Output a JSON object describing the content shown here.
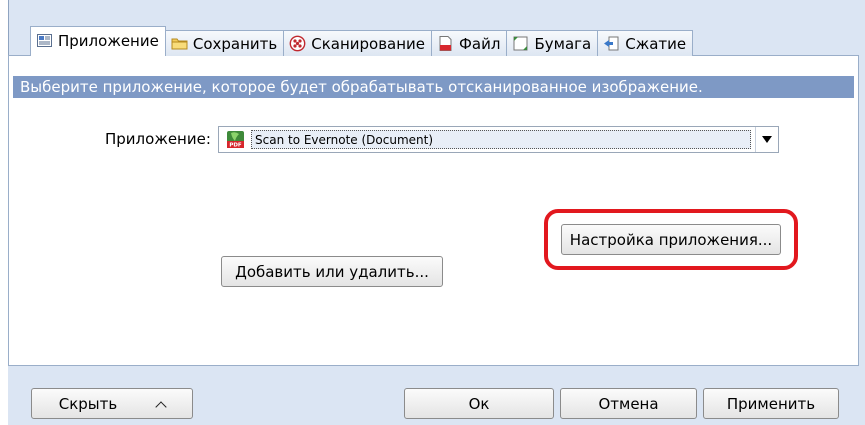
{
  "tabs": [
    {
      "label": "Приложение",
      "icon": "application-icon",
      "active": true
    },
    {
      "label": "Сохранить",
      "icon": "folder-icon",
      "active": false
    },
    {
      "label": "Сканирование",
      "icon": "scan-icon",
      "active": false
    },
    {
      "label": "Файл",
      "icon": "file-icon",
      "active": false
    },
    {
      "label": "Бумага",
      "icon": "paper-icon",
      "active": false
    },
    {
      "label": "Сжатие",
      "icon": "compression-icon",
      "active": false
    }
  ],
  "info_text": "Выберите приложение, которое будет обрабатывать отсканированное изображение.",
  "application": {
    "label": "Приложение:",
    "selected": "Scan to Evernote (Document)",
    "icon": "pdf-icon"
  },
  "buttons": {
    "app_settings": "Настройка приложения...",
    "add_remove": "Добавить или удалить...",
    "hide": "Скрыть",
    "ok": "Ок",
    "cancel": "Отмена",
    "apply": "Применить"
  },
  "colors": {
    "info_bar": "#7e99c5",
    "highlight": "#e2181e",
    "window_bg": "#dbe5f3"
  }
}
